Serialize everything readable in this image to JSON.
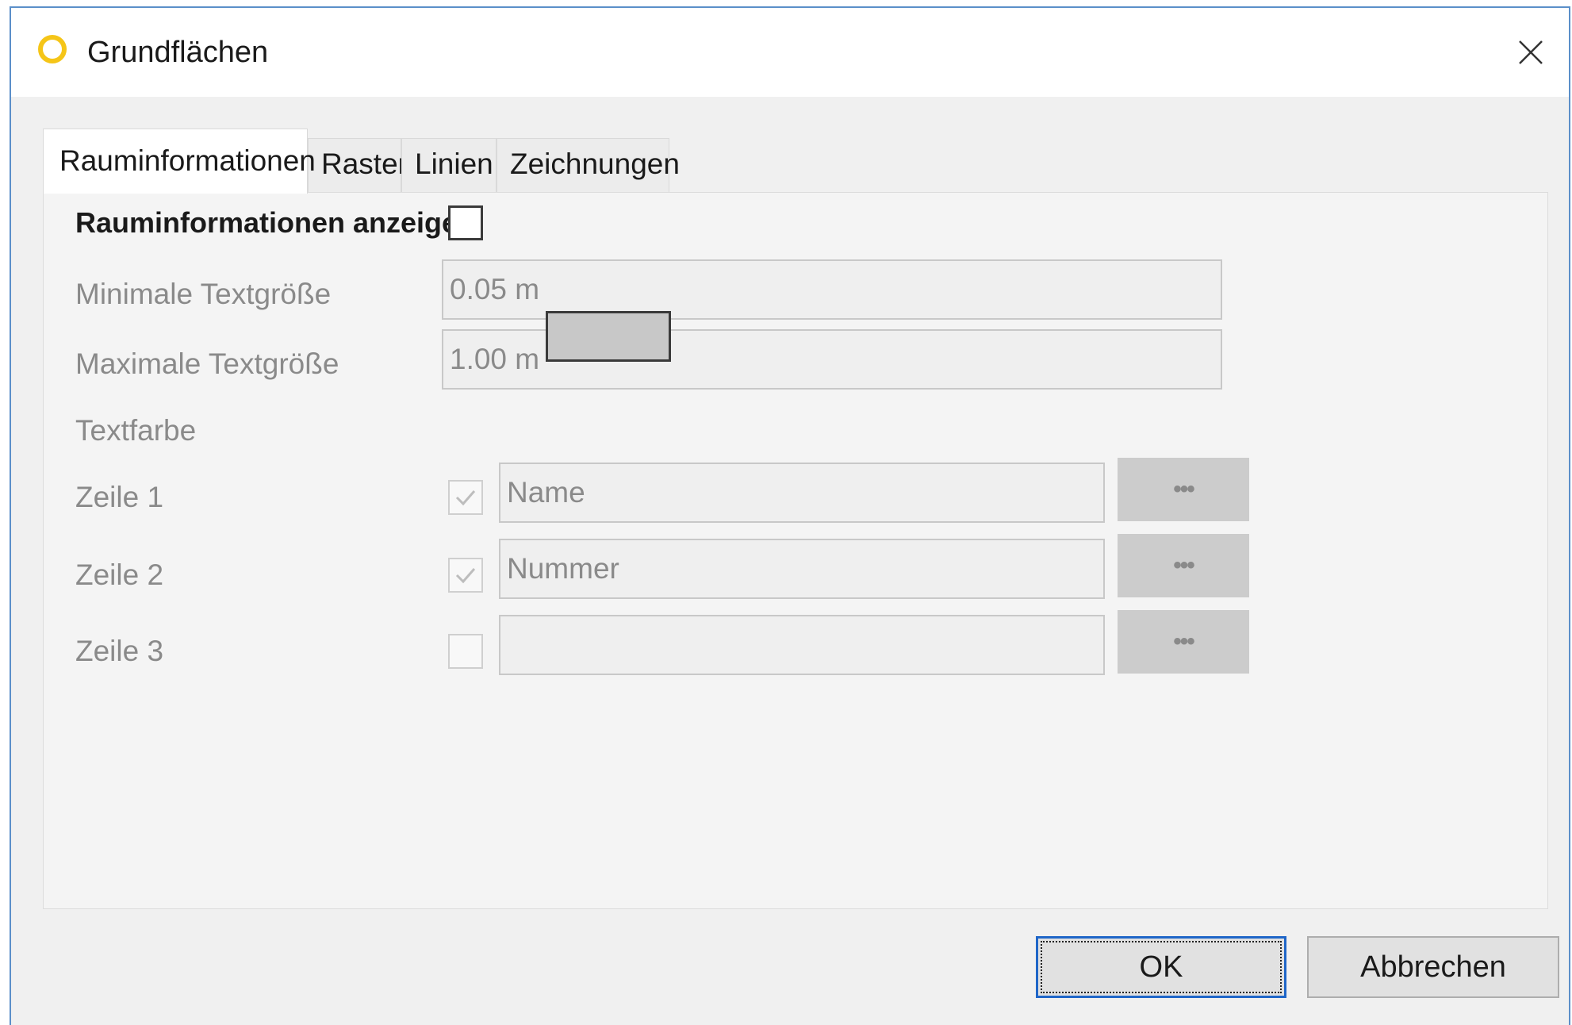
{
  "window": {
    "title": "Grundflächen",
    "icon": "app-ring-icon",
    "close_icon": "close-icon"
  },
  "tabs": [
    {
      "label": "Rauminformationen",
      "active": true
    },
    {
      "label": "Raster",
      "active": false
    },
    {
      "label": "Linien",
      "active": false
    },
    {
      "label": "Zeichnungen",
      "active": false
    }
  ],
  "form": {
    "show_info": {
      "label": "Rauminformationen anzeigen",
      "checked": false
    },
    "min_text_size": {
      "label": "Minimale Textgröße",
      "value": "0.05 m"
    },
    "max_text_size": {
      "label": "Maximale Textgröße",
      "value": "1.00 m"
    },
    "text_color": {
      "label": "Textfarbe",
      "color": "#c8c8c8"
    },
    "rows": [
      {
        "label": "Zeile 1",
        "checked": true,
        "value": "Name",
        "button": "•••"
      },
      {
        "label": "Zeile 2",
        "checked": true,
        "value": "Nummer",
        "button": "•••"
      },
      {
        "label": "Zeile 3",
        "checked": false,
        "value": "",
        "button": "•••"
      }
    ]
  },
  "buttons": {
    "ok": "OK",
    "cancel": "Abbrechen"
  },
  "colors": {
    "accent": "#1f66c8",
    "icon_yellow": "#f5c518",
    "window_border": "#5b8fc9"
  }
}
